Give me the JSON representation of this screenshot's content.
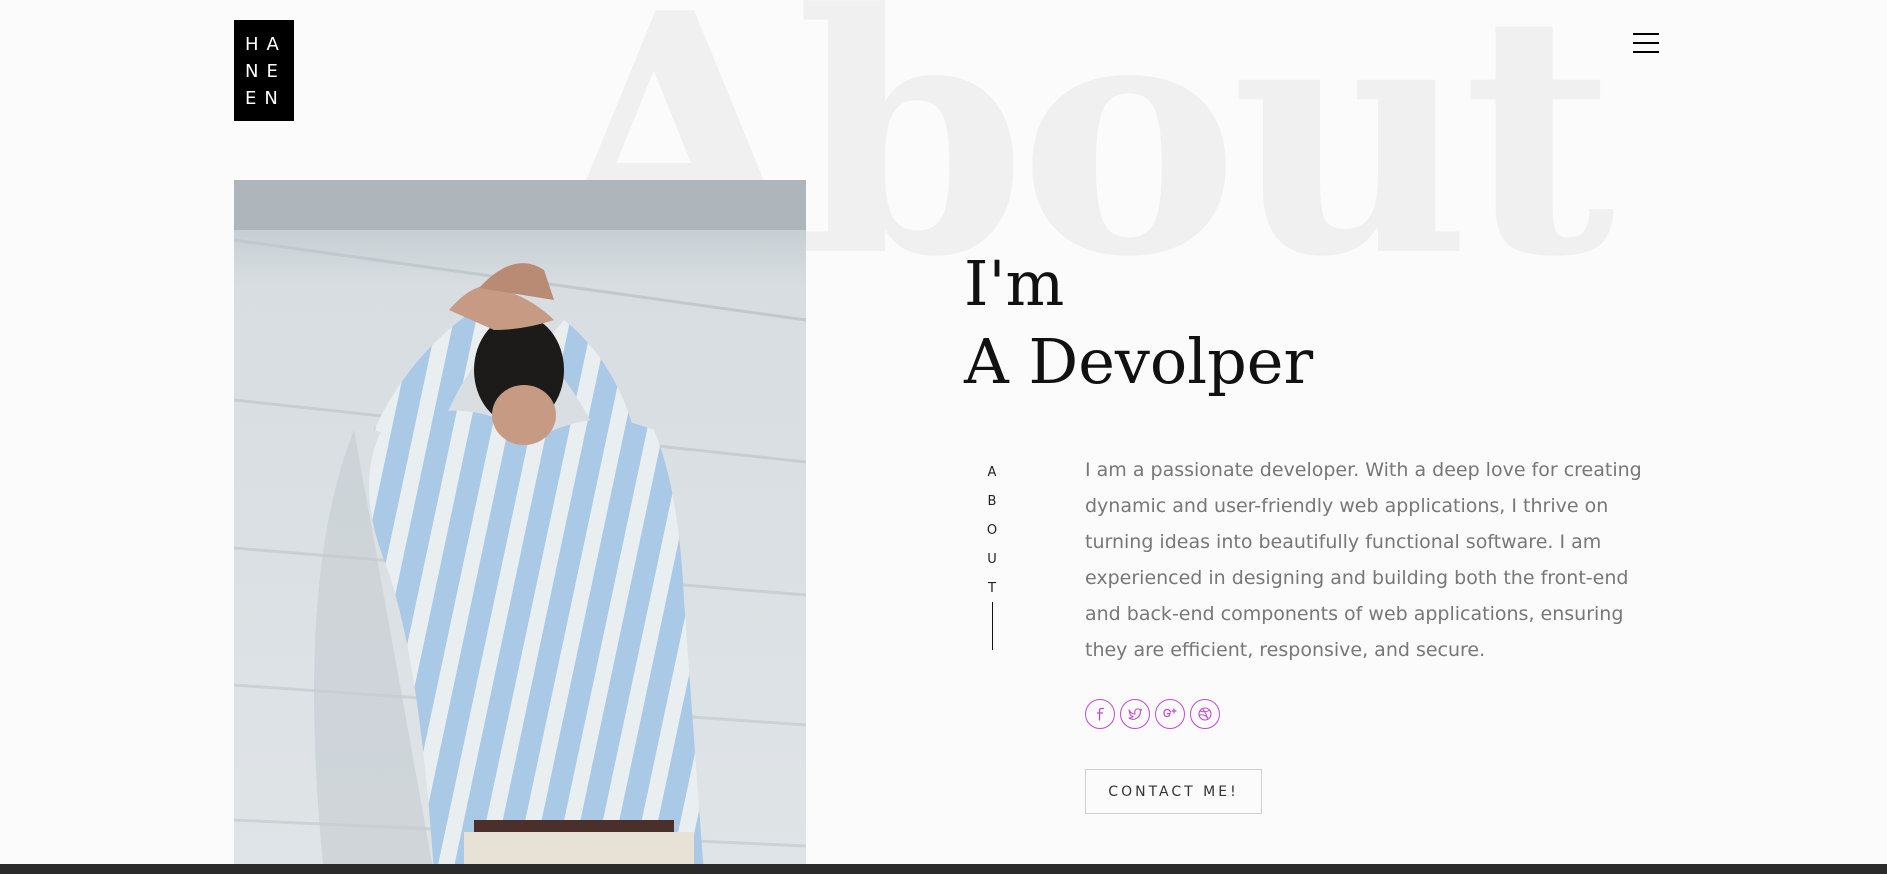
{
  "background_word": "About",
  "logo": {
    "lines": [
      "HA",
      "NE",
      "EN"
    ]
  },
  "menu": {
    "icon": "hamburger-icon"
  },
  "hero": {
    "line1": "I'm",
    "line2": "A Devolper"
  },
  "side_label": {
    "chars": [
      "A",
      "B",
      "O",
      "U",
      "T"
    ]
  },
  "bio": "I am a passionate developer. With a deep love for creating dynamic and user-friendly web applications, I thrive on turning ideas into beautifully functional software. I am experienced in designing and building both the front-end and back-end components of web applications, ensuring they are efficient, responsive, and secure.",
  "socials": [
    {
      "icon": "facebook-icon",
      "glyph": "f"
    },
    {
      "icon": "twitter-icon",
      "glyph": "bird"
    },
    {
      "icon": "google-plus-icon",
      "glyph": "g+"
    },
    {
      "icon": "dribbble-icon",
      "glyph": "ball"
    }
  ],
  "contact_button": {
    "label": "CONTACT ME!"
  },
  "colors": {
    "accent": "#c04ad0",
    "background": "#fbfbfb",
    "background_word": "#f0f0f0",
    "text_muted": "#777777",
    "logo_bg": "#000000"
  }
}
